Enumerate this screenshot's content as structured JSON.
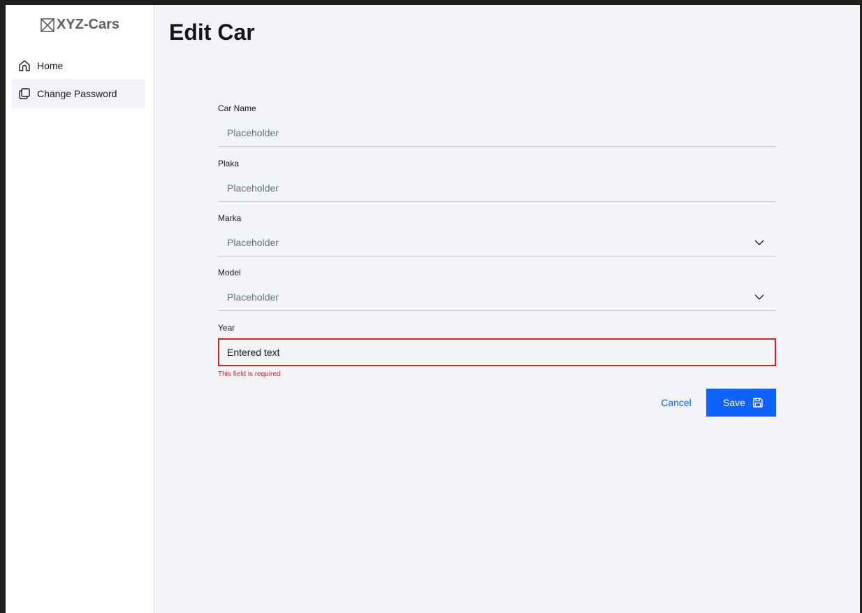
{
  "app": {
    "brand_name": "XYZ-Cars",
    "brand_icon": "image-placeholder-icon"
  },
  "sidebar": {
    "items": [
      {
        "label": "Home",
        "icon": "home-icon",
        "active": false
      },
      {
        "label": "Change Password",
        "icon": "copy-icon",
        "active": true
      }
    ]
  },
  "page": {
    "title": "Edit Car"
  },
  "form": {
    "car_name": {
      "label": "Car Name",
      "placeholder": "Placeholder"
    },
    "plaka": {
      "label": "Plaka",
      "placeholder": "Placeholder"
    },
    "marka": {
      "label": "Marka",
      "placeholder": "Placeholder",
      "type": "select",
      "icon": "chevron-down-icon"
    },
    "model": {
      "label": "Model",
      "placeholder": "Placeholder",
      "type": "select",
      "icon": "chevron-down-icon"
    },
    "year": {
      "label": "Year",
      "value": "Entered text",
      "error": "This field is required"
    },
    "cancel_label": "Cancel",
    "save_label": "Save",
    "save_icon": "save-icon"
  },
  "colors": {
    "primary": "#0f62fe",
    "error": "#da1e28",
    "background": "#f2f4f8",
    "sidebar": "#ffffff"
  }
}
